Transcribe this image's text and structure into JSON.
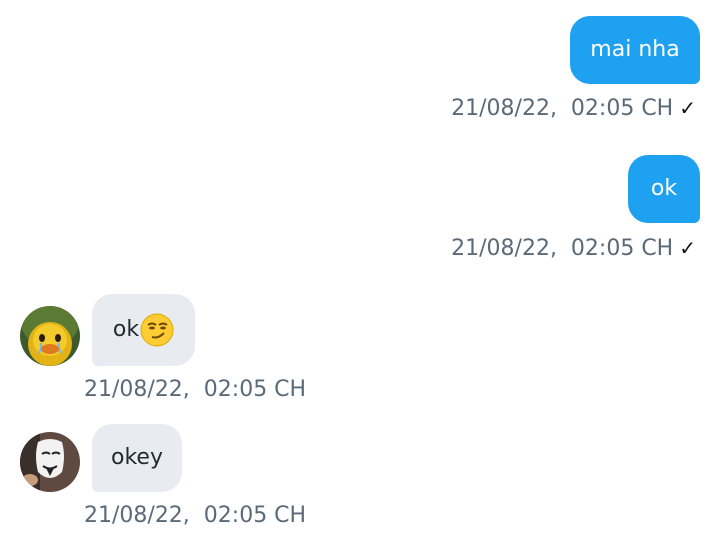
{
  "messages": [
    {
      "direction": "outgoing",
      "text": "mai nha",
      "timestamp": "21/08/22,  02:05 CH",
      "status": "sent"
    },
    {
      "direction": "outgoing",
      "text": "ok",
      "timestamp": "21/08/22,  02:05 CH",
      "status": "sent"
    },
    {
      "direction": "incoming",
      "text": "ok",
      "emoji": "smirking-face",
      "timestamp": "21/08/22,  02:05 CH",
      "avatar": "duck-avatar"
    },
    {
      "direction": "incoming",
      "text": "okey",
      "timestamp": "21/08/22,  02:05 CH",
      "avatar": "mask-avatar"
    }
  ],
  "check_mark": "✓",
  "colors": {
    "outgoing_bubble": "#1ea1f1",
    "incoming_bubble": "#e8ecf0",
    "timestamp": "#5b6a78"
  }
}
